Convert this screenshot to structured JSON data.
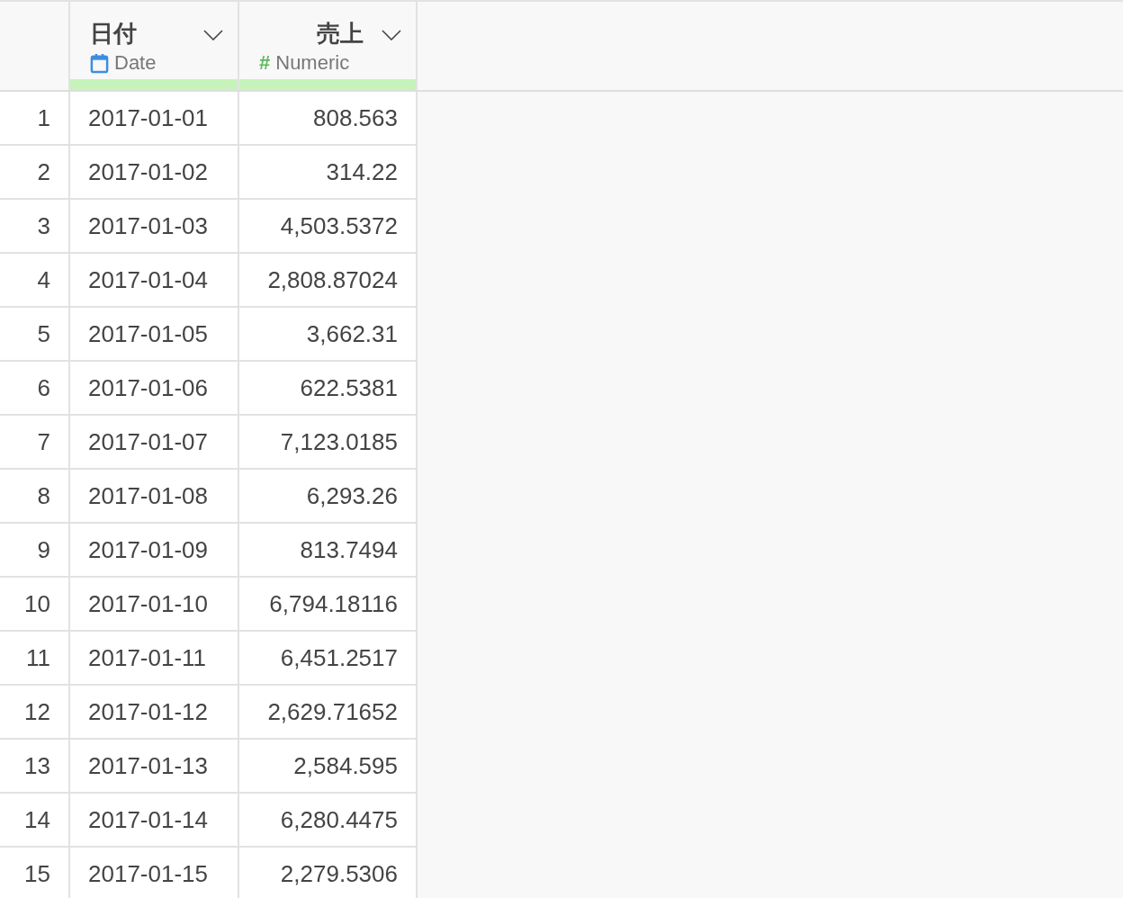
{
  "columns": [
    {
      "name": "日付",
      "kind": "date",
      "type_label": "Date",
      "level": 1
    },
    {
      "name": "売上",
      "kind": "numeric",
      "type_symbol": "#",
      "type_label": "Numeric",
      "level": 1
    }
  ],
  "rows": [
    {
      "number": "1",
      "cells": [
        "2017-01-01",
        "808.563"
      ]
    },
    {
      "number": "2",
      "cells": [
        "2017-01-02",
        "314.22"
      ]
    },
    {
      "number": "3",
      "cells": [
        "2017-01-03",
        "4,503.5372"
      ]
    },
    {
      "number": "4",
      "cells": [
        "2017-01-04",
        "2,808.87024"
      ]
    },
    {
      "number": "5",
      "cells": [
        "2017-01-05",
        "3,662.31"
      ]
    },
    {
      "number": "6",
      "cells": [
        "2017-01-06",
        "622.5381"
      ]
    },
    {
      "number": "7",
      "cells": [
        "2017-01-07",
        "7,123.0185"
      ]
    },
    {
      "number": "8",
      "cells": [
        "2017-01-08",
        "6,293.26"
      ]
    },
    {
      "number": "9",
      "cells": [
        "2017-01-09",
        "813.7494"
      ]
    },
    {
      "number": "10",
      "cells": [
        "2017-01-10",
        "6,794.18116"
      ]
    },
    {
      "number": "11",
      "cells": [
        "2017-01-11",
        "6,451.2517"
      ]
    },
    {
      "number": "12",
      "cells": [
        "2017-01-12",
        "2,629.71652"
      ]
    },
    {
      "number": "13",
      "cells": [
        "2017-01-13",
        "2,584.595"
      ]
    },
    {
      "number": "14",
      "cells": [
        "2017-01-14",
        "6,280.4475"
      ]
    },
    {
      "number": "15",
      "cells": [
        "2017-01-15",
        "2,279.5306"
      ]
    }
  ]
}
